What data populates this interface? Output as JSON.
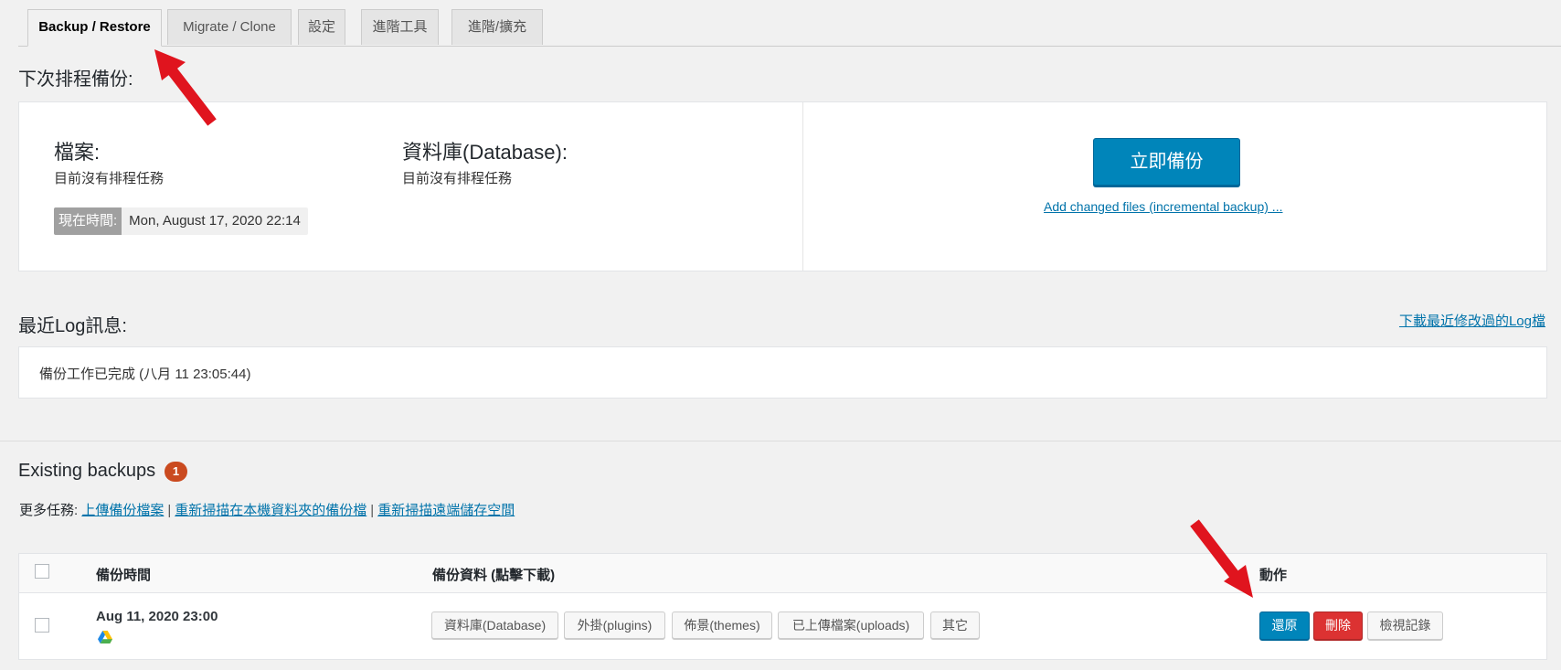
{
  "tabs": [
    {
      "label": "Backup / Restore",
      "active": true
    },
    {
      "label": "Migrate / Clone"
    },
    {
      "label": "設定"
    },
    {
      "label": "進階工具"
    },
    {
      "label": "進階/擴充"
    }
  ],
  "schedule": {
    "title": "下次排程備份:",
    "files_label": "檔案:",
    "files_status": "目前沒有排程任務",
    "db_label": "資料庫(Database):",
    "db_status": "目前沒有排程任務",
    "time_key": "現在時間:",
    "time_value": "Mon, August 17, 2020 22:14",
    "backup_now": "立即備份",
    "incremental_link": "Add changed files (incremental backup) ..."
  },
  "log": {
    "title": "最近Log訊息:",
    "download_link": "下載最近修改過的Log檔",
    "message": "備份工作已完成 (八月 11 23:05:44)"
  },
  "existing": {
    "title": "Existing backups",
    "count": "1",
    "more_tasks_label": "更多任務:",
    "links": [
      "上傳備份檔案",
      "重新掃描在本機資料夾的備份檔",
      "重新掃描遠端儲存空間"
    ]
  },
  "table": {
    "headers": {
      "time": "備份時間",
      "data": "備份資料 (點擊下載)",
      "action": "動作"
    },
    "rows": [
      {
        "date": "Aug 11, 2020 23:00",
        "storage_icon": "google-drive-icon",
        "chips": [
          "資料庫(Database)",
          "外掛(plugins)",
          "佈景(themes)",
          "已上傳檔案(uploads)",
          "其它"
        ],
        "actions": {
          "restore": "還原",
          "delete": "刪除",
          "view_log": "檢視記錄"
        }
      }
    ]
  },
  "colors": {
    "primary": "#0085ba",
    "danger": "#dc3232",
    "badge": "#ca4a1f",
    "arrow": "#e0141e"
  }
}
